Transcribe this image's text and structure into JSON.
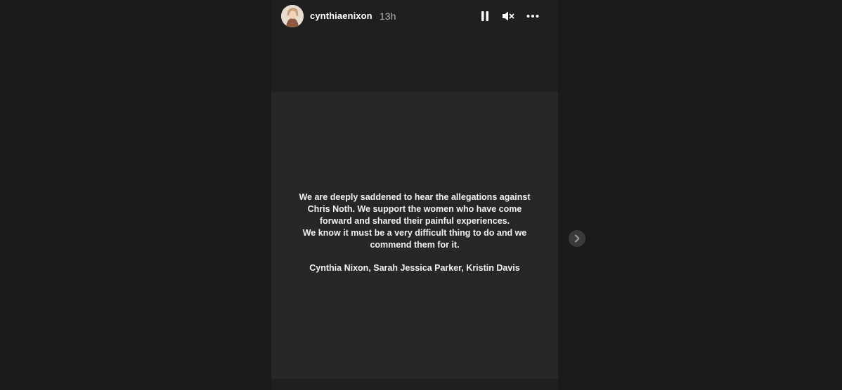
{
  "story": {
    "username": "cynthiaenixon",
    "timestamp": "13h",
    "message_lines": [
      "We are deeply saddened to hear the allegations against",
      "Chris Noth. We support the women who have come",
      "forward and shared their painful experiences.",
      "We know it must be a very difficult thing to do and we",
      "commend them for it."
    ],
    "signature": "Cynthia Nixon, Sarah Jessica Parker, Kristin Davis"
  },
  "controls": {
    "pause_icon": "pause-icon",
    "mute_icon": "muted-speaker-icon",
    "more_icon": "ellipsis-icon",
    "next_icon": "chevron-right-icon"
  },
  "colors": {
    "page_background": "#1a1a1a",
    "story_panel": "#272727",
    "text": "#f2f2f2",
    "timestamp": "#b5b5b5"
  }
}
